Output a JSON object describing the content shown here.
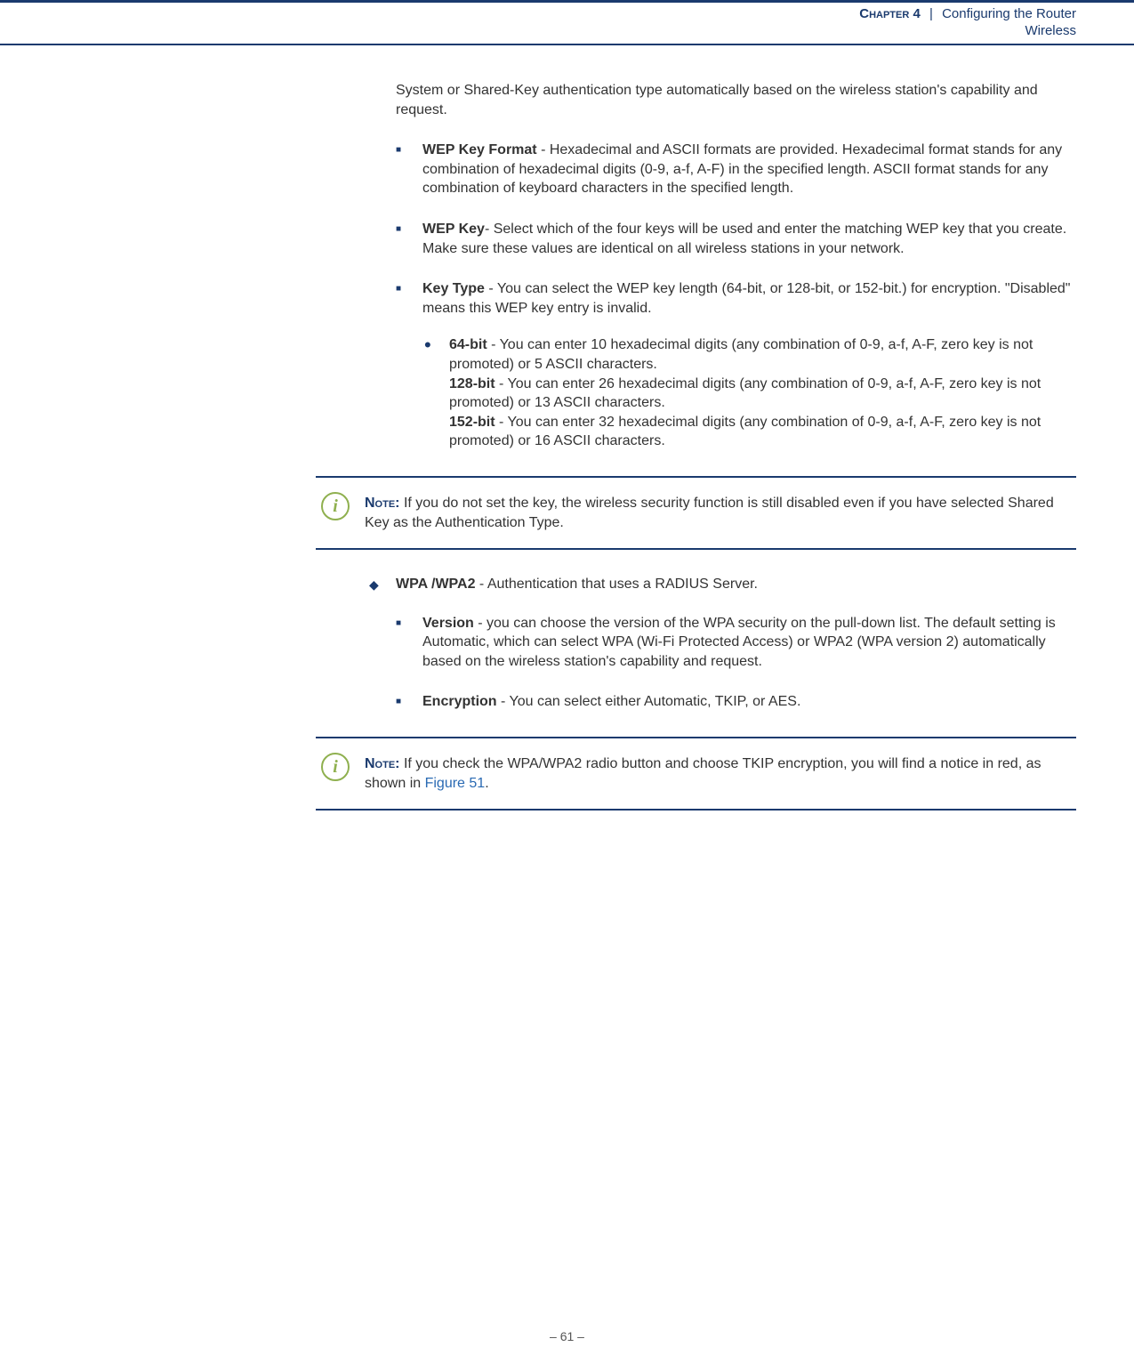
{
  "header": {
    "chapter_label": "Chapter 4",
    "separator": "|",
    "title": "Configuring the Router",
    "subtitle": "Wireless"
  },
  "intro": "System or Shared-Key authentication type automatically based on the wireless station's capability and request.",
  "items": {
    "wep_key_format": {
      "label": "WEP Key Format",
      "text": " - Hexadecimal and ASCII formats are provided. Hexadecimal format stands for any combination of hexadecimal digits (0-9, a-f, A-F) in the specified length. ASCII format stands for any combination of keyboard characters in the specified length."
    },
    "wep_key": {
      "label": "WEP Key",
      "text": "- Select which of the four keys will be used and enter the matching WEP key that you create. Make sure these values are identical on all wireless stations in your network."
    },
    "key_type": {
      "label": "Key Type",
      "text": " - You can select the WEP key length (64-bit, or 128-bit, or 152-bit.) for encryption. \"Disabled\" means this WEP key entry is invalid.",
      "sub": {
        "b64_label": "64-bit",
        "b64_text": " - You can enter 10 hexadecimal digits (any combination of 0-9, a-f, A-F, zero key is not promoted) or 5 ASCII characters.",
        "b128_label": "128-bit",
        "b128_text": " - You can enter 26 hexadecimal digits (any combination of 0-9, a-f, A-F, zero key is not promoted) or 13 ASCII characters.",
        "b152_label": "152-bit",
        "b152_text": " - You can enter 32 hexadecimal digits (any combination of 0-9, a-f, A-F, zero key is not promoted) or 16 ASCII characters."
      }
    }
  },
  "note1": {
    "label": "Note:",
    "text": " If you do not set the key, the wireless security function is still disabled even if you have selected Shared Key as the Authentication Type."
  },
  "wpa": {
    "label": "WPA /WPA2",
    "text": " - Authentication that uses a RADIUS Server.",
    "version": {
      "label": "Version",
      "text": " - you can choose the version of the WPA security on the pull-down list. The default setting is Automatic, which can select WPA (Wi-Fi Protected Access) or WPA2 (WPA version 2) automatically based on the wireless station's capability and request."
    },
    "encryption": {
      "label": "Encryption",
      "text": " - You can select either Automatic, TKIP, or AES."
    }
  },
  "note2": {
    "label": "Note:",
    "text_before": " If you check the WPA/WPA2 radio button and choose TKIP encryption, you will find a notice in red, as shown in ",
    "figlink": "Figure 51",
    "text_after": "."
  },
  "footer": "–  61  –",
  "icon_glyph": "i"
}
